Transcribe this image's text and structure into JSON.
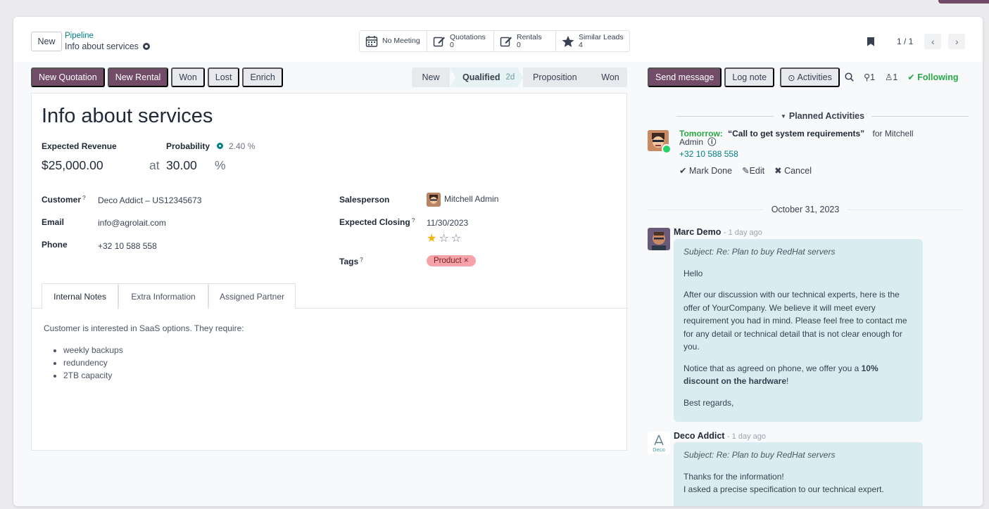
{
  "toolbar": {
    "new_label": "New",
    "breadcrumb_parent": "Pipeline",
    "breadcrumb_current": "Info about services"
  },
  "smart_buttons": [
    {
      "label": "No Meeting",
      "count": "",
      "icon": "calendar-icon"
    },
    {
      "label": "Quotations",
      "count": "0",
      "icon": "edit-icon"
    },
    {
      "label": "Rentals",
      "count": "0",
      "icon": "edit-icon"
    },
    {
      "label": "Similar Leads",
      "count": "4",
      "icon": "star-icon"
    }
  ],
  "pager": {
    "value": "1 / 1"
  },
  "status_buttons": {
    "new_quotation": "New Quotation",
    "new_rental": "New Rental",
    "won": "Won",
    "lost": "Lost",
    "enrich": "Enrich"
  },
  "stages": {
    "s1": "New",
    "s2": "Qualified",
    "s2_duration": "2d",
    "s3": "Proposition",
    "s4": "Won"
  },
  "form": {
    "title": "Info about services",
    "expected_revenue_label": "Expected Revenue",
    "expected_revenue": "$25,000.00",
    "probability_label": "Probability",
    "probability_hint": "2.40 %",
    "at_label": "at",
    "probability_value": "30.00",
    "percent": "%",
    "customer_label": "Customer",
    "customer": "Deco Addict – US12345673",
    "email_label": "Email",
    "email": "info@agrolait.com",
    "phone_label": "Phone",
    "phone": "+32 10 588 558",
    "salesperson_label": "Salesperson",
    "salesperson": "Mitchell Admin",
    "closing_label": "Expected Closing",
    "closing": "11/30/2023",
    "priority_stars": 1,
    "priority_max": 3,
    "tags_label": "Tags",
    "tag": "Product",
    "qmark": "?"
  },
  "tabs": {
    "internal_notes": "Internal Notes",
    "extra_info": "Extra Information",
    "assigned_partner": "Assigned Partner"
  },
  "notes": {
    "intro": "Customer is interested in SaaS options. They require:",
    "items": [
      "weekly backups",
      "redundency",
      "2TB capacity"
    ]
  },
  "chatter": {
    "send_message": "Send message",
    "log_note": "Log note",
    "activities": "Activities",
    "attachments_count": "1",
    "followers_count": "1",
    "following": "Following",
    "planned_activities": "Planned Activities",
    "activity": {
      "when": "Tomorrow:",
      "summary": "“Call to get system requirements”",
      "for": "for Mitchell",
      "assignee": "Admin",
      "phone": "+32 10 588 558",
      "mark_done": "Mark Done",
      "edit": "Edit",
      "cancel": "Cancel"
    },
    "date_separator": "October 31, 2023",
    "messages": [
      {
        "author": "Marc Demo",
        "ago": "- 1 day ago",
        "subject": "Subject: Re: Plan to buy RedHat servers",
        "greeting": "Hello",
        "body1": "After our discussion with our technical experts, here is the offer of YourCompany. We believe it will meet every requirement you had in mind. Please feel free to contact me for any detail or technical detail that is not clear enough for you.",
        "body2_pre": "Notice that as agreed on phone, we offer you a ",
        "body2_bold": "10% discount on the hardware",
        "body2_post": "!",
        "closing": "Best regards,"
      },
      {
        "author": "Deco Addict",
        "ago": "- 1 day ago",
        "subject": "Subject: Re: Plan to buy RedHat servers",
        "line1": "Thanks for the information!",
        "line2": "I asked a precise specification to our technical expert."
      }
    ],
    "deco_logo_text": "Deco"
  },
  "colors": {
    "primary": "#714b67",
    "link": "#017e84",
    "success": "#28a745",
    "bubble": "#d9edf1",
    "tag": "#f5a3a8"
  }
}
